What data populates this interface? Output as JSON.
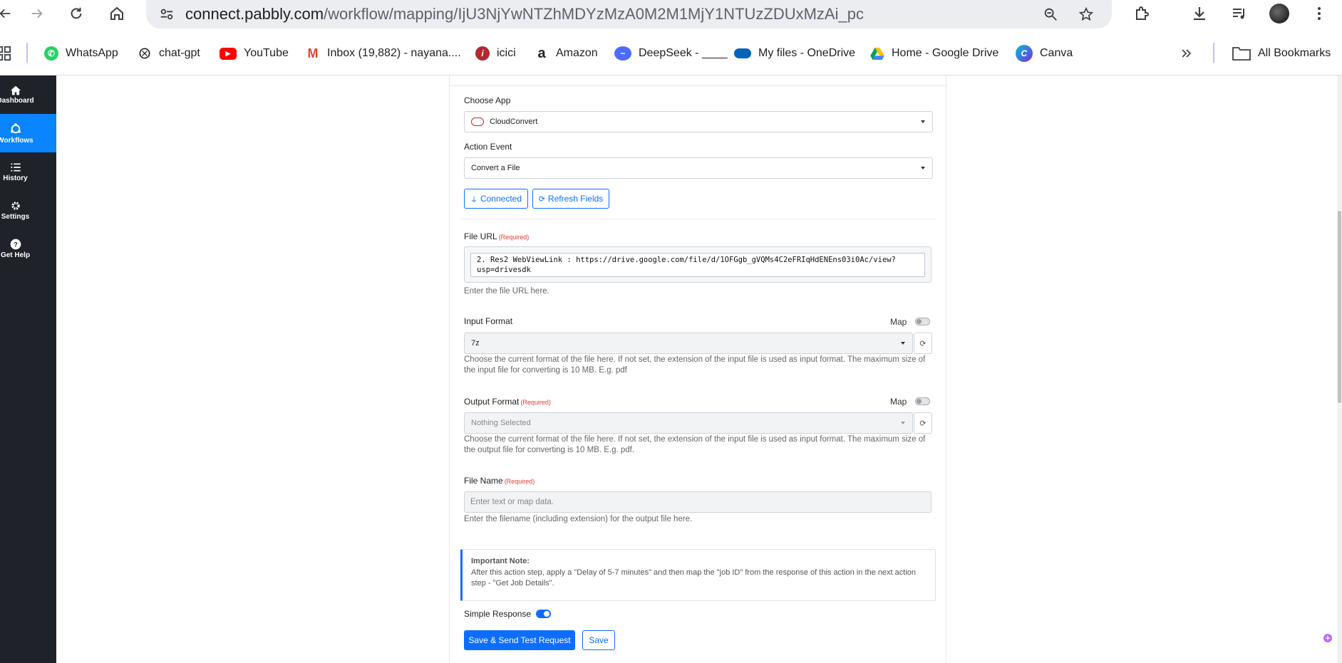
{
  "browser": {
    "url_domain": "connect.pabbly.com",
    "url_path": "/workflow/mapping/IjU3NjYwNTZhMDYzMzA0M2M1MjY1NTUzZDUxMzAi_pc"
  },
  "bookmarks": [
    {
      "label": "WhatsApp",
      "icon": "whatsapp-icon",
      "color": "#25d366"
    },
    {
      "label": "chat-gpt",
      "icon": "openai-icon",
      "color": "#222222"
    },
    {
      "label": "YouTube",
      "icon": "youtube-icon",
      "color": "#ff0000"
    },
    {
      "label": "Inbox (19,882) - nayana....",
      "icon": "gmail-icon",
      "color": "#ea4335"
    },
    {
      "label": "icici",
      "icon": "icici-icon",
      "color": "#b02a30"
    },
    {
      "label": "Amazon",
      "icon": "amazon-icon",
      "color": "#222222"
    },
    {
      "label": "DeepSeek - ____",
      "icon": "deepseek-icon",
      "color": "#4d6bfe"
    },
    {
      "label": "My files - OneDrive",
      "icon": "onedrive-icon",
      "color": "#0364b8"
    },
    {
      "label": "Home - Google Drive",
      "icon": "google-drive-icon",
      "color": "#0f9d58"
    },
    {
      "label": "Canva",
      "icon": "canva-icon",
      "color": "#00c4cc"
    }
  ],
  "all_bookmarks_label": "All Bookmarks",
  "sidebar": {
    "items": [
      {
        "label": "Dashboard",
        "icon": "home-icon"
      },
      {
        "label": "Workflows",
        "icon": "workflow-icon"
      },
      {
        "label": "History",
        "icon": "list-icon"
      },
      {
        "label": "Settings",
        "icon": "gear-icon"
      },
      {
        "label": "Get Help",
        "icon": "help-icon"
      }
    ],
    "active": "Workflows"
  },
  "form": {
    "choose_app_label": "Choose App",
    "choose_app_value": "CloudConvert",
    "action_event_label": "Action Event",
    "action_event_value": "Convert a File",
    "connected_label": "Connected",
    "refresh_fields_label": "Refresh Fields",
    "file_url_label": "File URL",
    "required_tag": "(Required)",
    "file_url_value": "2. Res2 WebViewLink : https://drive.google.com/file/d/1OFGgb_gVQMs4C2eFRIqHdENEns03i0Ac/view?usp=drivesdk",
    "file_url_help": "Enter the file URL here.",
    "input_format_label": "Input Format",
    "map_label": "Map",
    "input_format_value": "7z",
    "input_format_help": "Choose the current format of the file here. If not set, the extension of the input file is used as input format. The maximum size of the input file for converting is 10 MB. E.g. pdf",
    "output_format_label": "Output Format",
    "output_format_value": "Nothing Selected",
    "output_format_help": "Choose the current format of the file here. If not set, the extension of the input file is used as input format. The maximum size of the output file for converting is 10 MB. E.g. pdf.",
    "file_name_label": "File Name",
    "file_name_placeholder": "Enter text or map data.",
    "file_name_help": "Enter the filename (including extension) for the output file here.",
    "note_title": "Important Note:",
    "note_text": "After this action step, apply a \"Delay of 5-7 minutes\" and then map the \"job ID\" from the response of this action in the next action step - \"Get Job Details\".",
    "simple_response_label": "Simple Response",
    "simple_response_on": true,
    "save_send_label": "Save & Send Test Request",
    "save_label": "Save"
  },
  "colors": {
    "primary": "#0d6efd",
    "sidebar_bg": "#1f2329",
    "sidebar_active": "#0a84ff",
    "required": "#e53935"
  }
}
